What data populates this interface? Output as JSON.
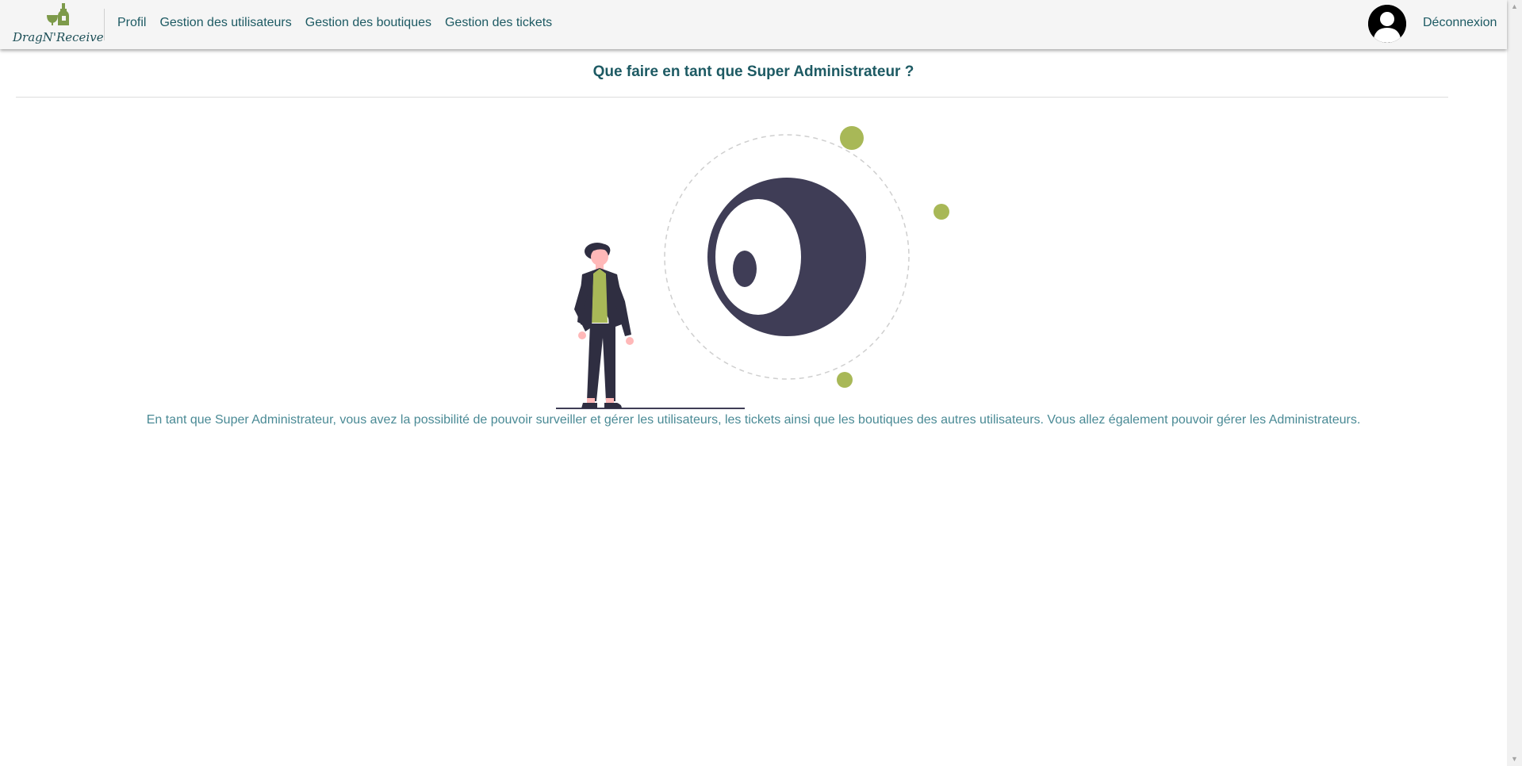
{
  "navbar": {
    "brand": "DragN'Receive",
    "brand_icon": "bottle-and-glass-logo",
    "links": [
      {
        "label": "Profil"
      },
      {
        "label": "Gestion des utilisateurs"
      },
      {
        "label": "Gestion des boutiques"
      },
      {
        "label": "Gestion des tickets"
      }
    ],
    "avatar_icon": "user-avatar-icon",
    "logout_label": "Déconnexion"
  },
  "main": {
    "title": "Que faire en tant que Super Administrateur ?",
    "description": "En tant que Super Administrateur, vous avez la possibilité de pouvoir surveiller et gérer les utilisateurs, les tickets ainsi que les boutiques des autres utilisateurs. Vous allez également pouvoir gérer les Administrateurs.",
    "illustration": "person-looking-at-eye-illustration"
  },
  "colors": {
    "primary_text": "#1d5a63",
    "description_text": "#4a8a95",
    "accent_green": "#a8b857",
    "dark_shape": "#3f3d56",
    "navbar_bg": "#f5f5f5"
  }
}
